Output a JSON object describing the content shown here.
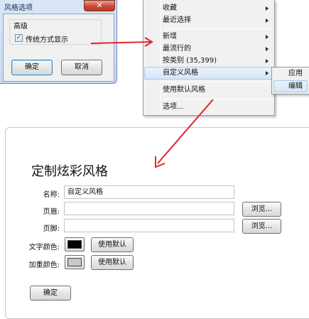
{
  "dialog": {
    "title": "风格选项",
    "close_glyph": "✕",
    "group_label": "高级",
    "checkbox_label": "传统方式显示",
    "checkbox_mark": "✓",
    "ok_label": "确定",
    "cancel_label": "取消"
  },
  "menu": {
    "items": [
      {
        "label": "收藏",
        "submenu": true
      },
      {
        "label": "最近选择",
        "submenu": true
      },
      {
        "label": "新增",
        "submenu": true
      },
      {
        "label": "最流行的",
        "submenu": true
      },
      {
        "label": "按类别 (35,399)",
        "submenu": true
      },
      {
        "label": "自定义风格",
        "submenu": true,
        "highlighted": true
      },
      {
        "label": "使用默认风格",
        "submenu": false
      },
      {
        "label": "选项...",
        "submenu": false
      }
    ],
    "submenu_items": [
      {
        "label": "应用"
      },
      {
        "label": "编辑",
        "highlighted": true
      }
    ]
  },
  "panel": {
    "title": "定制炫彩风格",
    "name_label": "名称:",
    "name_value": "自定义风格",
    "header_label": "页眉:",
    "header_value": "",
    "footer_label": "页脚:",
    "footer_value": "",
    "browse_label": "浏览...",
    "text_color_label": "文字颜色:",
    "text_color": "#000000",
    "highlight_color_label": "加重颜色:",
    "highlight_color": "#c8c8c8",
    "use_default_label": "使用默认",
    "ok_label": "确定"
  },
  "colors": {
    "annotation_arrow": "#e0262f",
    "menu_highlight": "#d6e6f7"
  }
}
